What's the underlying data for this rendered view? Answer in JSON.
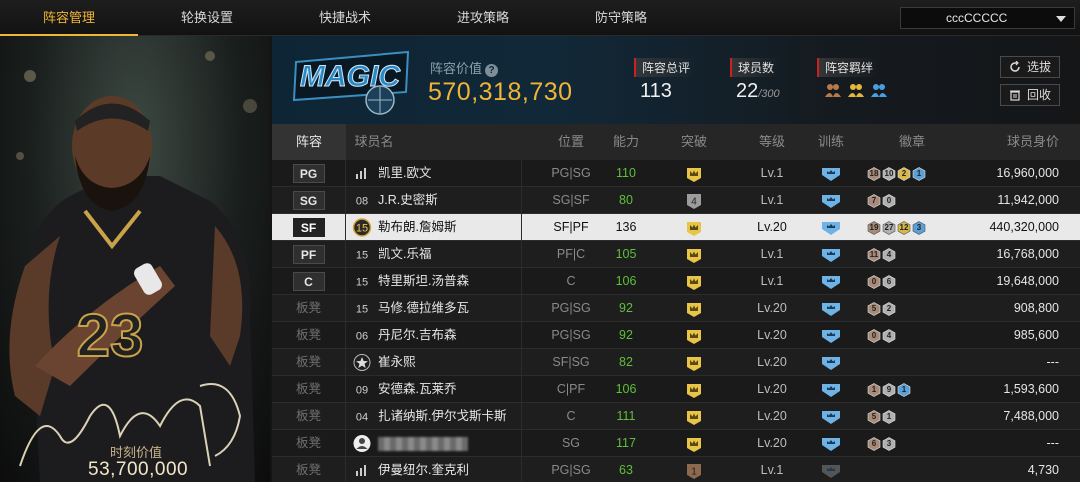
{
  "nav": {
    "tabs": [
      "阵容管理",
      "轮换设置",
      "快捷战术",
      "进攻策略",
      "防守策略"
    ],
    "active": 0,
    "account": "cccCCCCC"
  },
  "card": {
    "moment_label": "时刻价值",
    "moment_value": "53,700,000",
    "jersey": "23"
  },
  "team": {
    "logo_text": "MAGIC",
    "value_label": "阵容价值",
    "value": "570,318,730",
    "stats": [
      {
        "label": "阵容总评",
        "value": "113",
        "sub": ""
      },
      {
        "label": "球员数",
        "value": "22",
        "sub": "/300"
      },
      {
        "label": "阵容羁绊",
        "value": "",
        "sub": ""
      }
    ],
    "buttons": {
      "select": "选拔",
      "recycle": "回收"
    }
  },
  "table": {
    "headers": [
      "阵容",
      "球员名",
      "位置",
      "能力",
      "突破",
      "等级",
      "训练",
      "徽章",
      "球员身价"
    ],
    "rows": [
      {
        "slot": "PG",
        "starter": true,
        "num": "",
        "numtype": "bars",
        "name": "凯里.欧文",
        "role": "PG|SG",
        "abil": "110",
        "brk": "crown",
        "brkn": "",
        "lvl": "Lv.1",
        "train": true,
        "badges": [
          [
            "18",
            "#a88a78"
          ],
          [
            "10",
            "#b0b0b0"
          ],
          [
            "2",
            "#d9b84a"
          ],
          [
            "1",
            "#5aa0d8"
          ]
        ],
        "price": "16,960,000"
      },
      {
        "slot": "SG",
        "starter": true,
        "num": "08",
        "numtype": "text",
        "name": "J.R.史密斯",
        "role": "SG|SF",
        "abil": "80",
        "brk": "silver",
        "brkn": "4",
        "lvl": "Lv.1",
        "train": true,
        "badges": [
          [
            "7",
            "#a88a78"
          ],
          [
            "0",
            "#b0b0b0"
          ]
        ],
        "price": "11,942,000"
      },
      {
        "slot": "SF",
        "starter": true,
        "num": "15",
        "numtype": "gold",
        "name": "勒布朗.詹姆斯",
        "role": "SF|PF",
        "abil": "136",
        "brk": "crown",
        "brkn": "",
        "lvl": "Lv.20",
        "train": true,
        "badges": [
          [
            "19",
            "#a88a78"
          ],
          [
            "27",
            "#b0b0b0"
          ],
          [
            "12",
            "#d9b84a"
          ],
          [
            "3",
            "#5aa0d8"
          ]
        ],
        "price": "440,320,000"
      },
      {
        "slot": "PF",
        "starter": true,
        "num": "15",
        "numtype": "text",
        "name": "凯文.乐福",
        "role": "PF|C",
        "abil": "105",
        "brk": "crown",
        "brkn": "",
        "lvl": "Lv.1",
        "train": true,
        "badges": [
          [
            "11",
            "#a88a78"
          ],
          [
            "4",
            "#b0b0b0"
          ]
        ],
        "price": "16,768,000"
      },
      {
        "slot": "C",
        "starter": true,
        "num": "15",
        "numtype": "text",
        "name": "特里斯坦.汤普森",
        "role": "C",
        "abil": "106",
        "brk": "crown",
        "brkn": "",
        "lvl": "Lv.1",
        "train": true,
        "badges": [
          [
            "0",
            "#a88a78"
          ],
          [
            "6",
            "#b0b0b0"
          ]
        ],
        "price": "19,648,000"
      },
      {
        "slot": "板凳",
        "starter": false,
        "num": "15",
        "numtype": "text",
        "name": "马修.德拉维多瓦",
        "role": "PG|SG",
        "abil": "92",
        "brk": "crown",
        "brkn": "",
        "lvl": "Lv.20",
        "train": true,
        "badges": [
          [
            "5",
            "#a88a78"
          ],
          [
            "2",
            "#b0b0b0"
          ]
        ],
        "price": "908,800"
      },
      {
        "slot": "板凳",
        "starter": false,
        "num": "06",
        "numtype": "text",
        "name": "丹尼尔.吉布森",
        "role": "PG|SG",
        "abil": "92",
        "brk": "crown",
        "brkn": "",
        "lvl": "Lv.20",
        "train": true,
        "badges": [
          [
            "0",
            "#a88a78"
          ],
          [
            "4",
            "#b0b0b0"
          ]
        ],
        "price": "985,600"
      },
      {
        "slot": "板凳",
        "starter": false,
        "num": "",
        "numtype": "star",
        "name": "崔永熙",
        "role": "SF|SG",
        "abil": "82",
        "brk": "crown",
        "brkn": "",
        "lvl": "Lv.20",
        "train": true,
        "badges": [],
        "price": "---"
      },
      {
        "slot": "板凳",
        "starter": false,
        "num": "09",
        "numtype": "text",
        "name": "安德森.瓦莱乔",
        "role": "C|PF",
        "abil": "106",
        "brk": "crown",
        "brkn": "",
        "lvl": "Lv.20",
        "train": true,
        "badges": [
          [
            "1",
            "#a88a78"
          ],
          [
            "9",
            "#b0b0b0"
          ],
          [
            "1",
            "#5aa0d8"
          ]
        ],
        "price": "1,593,600"
      },
      {
        "slot": "板凳",
        "starter": false,
        "num": "04",
        "numtype": "text",
        "name": "扎诸纳斯.伊尔戈斯卡斯",
        "role": "C",
        "abil": "111",
        "brk": "crown",
        "brkn": "",
        "lvl": "Lv.20",
        "train": true,
        "badges": [
          [
            "5",
            "#a88a78"
          ],
          [
            "1",
            "#b0b0b0"
          ]
        ],
        "price": "7,488,000"
      },
      {
        "slot": "板凳",
        "starter": false,
        "num": "",
        "numtype": "person",
        "name": "",
        "role": "SG",
        "abil": "117",
        "brk": "crown",
        "brkn": "",
        "lvl": "Lv.20",
        "train": true,
        "badges": [
          [
            "6",
            "#a88a78"
          ],
          [
            "3",
            "#b0b0b0"
          ]
        ],
        "price": "---"
      },
      {
        "slot": "板凳",
        "starter": false,
        "num": "",
        "numtype": "bars",
        "name": "伊曼纽尔.奎克利",
        "role": "PG|SG",
        "abil": "63",
        "brk": "bronze",
        "brkn": "1",
        "lvl": "Lv.1",
        "train": false,
        "badges": [],
        "price": "4,730"
      }
    ]
  },
  "colors": {
    "accent": "#f2b636",
    "ability": "#5fbf3a",
    "selected_row": "#e9e9e9"
  }
}
